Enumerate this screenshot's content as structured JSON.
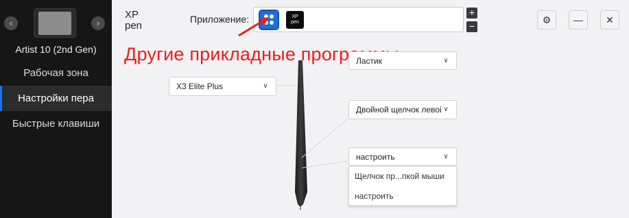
{
  "sidebar": {
    "prev_icon": "chevron-left-icon",
    "next_icon": "chevron-right-icon",
    "prev_glyph": "‹",
    "next_glyph": "›",
    "device_name": "Artist 10 (2nd Gen)",
    "items": [
      {
        "label": "Рабочая зона",
        "active": false
      },
      {
        "label": "Настройки пера",
        "active": true
      },
      {
        "label": "Быстрые клавиши",
        "active": false
      }
    ]
  },
  "header": {
    "logo_text_top": "XP",
    "logo_text_bottom": "pen",
    "app_label": "Приложение:",
    "xp_icon_top": "XP",
    "xp_icon_bottom": "pen",
    "plus_label": "+",
    "minus_label": "−",
    "settings_glyph": "⚙",
    "minimize_glyph": "—",
    "close_glyph": "✕"
  },
  "annotation": {
    "text": "Другие прикладные программы",
    "color": "#ee1c1c"
  },
  "pen": {
    "model_select": "X3 Elite Plus",
    "top_button": "Ластик",
    "middle_button": "Двойной щелчок левой",
    "lower_button": "настроить",
    "lower_options": [
      "Щелчок пр...пкой мыши",
      "настроить"
    ]
  },
  "colors": {
    "sidebar_bg": "#161616",
    "accent": "#1a73e8",
    "content_bg": "#f2f2f4"
  }
}
